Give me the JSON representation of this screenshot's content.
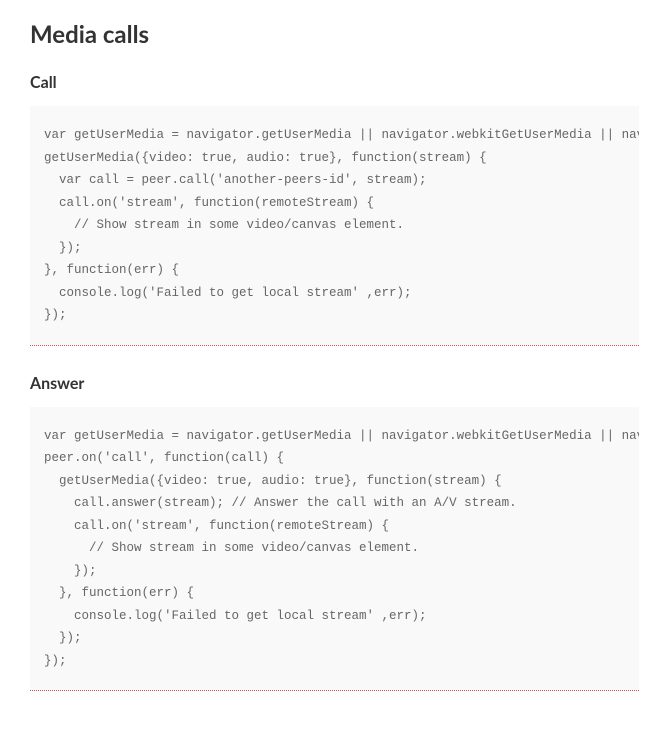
{
  "main_heading": "Media calls",
  "sections": [
    {
      "heading": "Call",
      "code": "var getUserMedia = navigator.getUserMedia || navigator.webkitGetUserMedia || navigator.mozGetUserMedia;\ngetUserMedia({video: true, audio: true}, function(stream) {\n  var call = peer.call('another-peers-id', stream);\n  call.on('stream', function(remoteStream) {\n    // Show stream in some video/canvas element.\n  });\n}, function(err) {\n  console.log('Failed to get local stream' ,err);\n});"
    },
    {
      "heading": "Answer",
      "code": "var getUserMedia = navigator.getUserMedia || navigator.webkitGetUserMedia || navigator.mozGetUserMedia;\npeer.on('call', function(call) {\n  getUserMedia({video: true, audio: true}, function(stream) {\n    call.answer(stream); // Answer the call with an A/V stream.\n    call.on('stream', function(remoteStream) {\n      // Show stream in some video/canvas element.\n    });\n  }, function(err) {\n    console.log('Failed to get local stream' ,err);\n  });\n});"
    }
  ]
}
